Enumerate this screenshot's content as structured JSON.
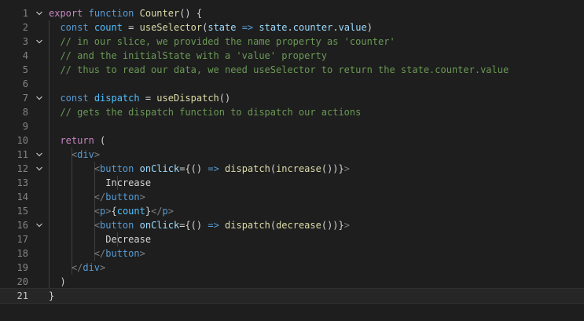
{
  "editor": {
    "language": "javascript-jsx",
    "colors": {
      "background": "#1e1e1e",
      "keyword": "#569cd6",
      "control": "#c586c0",
      "function": "#dcdcaa",
      "variable": "#9cdcfe",
      "constant": "#4fc1ff",
      "comment": "#6a9955",
      "tag_bracket": "#808080"
    },
    "current_line": 21,
    "lines": [
      {
        "number": "1",
        "fold": "chevron-down-icon",
        "guides": 0,
        "tokens": [
          {
            "t": "export",
            "c": "ctl"
          },
          {
            "t": " ",
            "c": "text"
          },
          {
            "t": "function",
            "c": "kw"
          },
          {
            "t": " ",
            "c": "text"
          },
          {
            "t": "Counter",
            "c": "fn"
          },
          {
            "t": "() {",
            "c": "punc"
          }
        ]
      },
      {
        "number": "2",
        "fold": "",
        "guides": 1,
        "tokens": [
          {
            "t": "  ",
            "c": "text"
          },
          {
            "t": "const",
            "c": "kw"
          },
          {
            "t": " ",
            "c": "text"
          },
          {
            "t": "count",
            "c": "const"
          },
          {
            "t": " = ",
            "c": "punc"
          },
          {
            "t": "useSelector",
            "c": "fn"
          },
          {
            "t": "(",
            "c": "punc"
          },
          {
            "t": "state",
            "c": "var"
          },
          {
            "t": " ",
            "c": "text"
          },
          {
            "t": "=>",
            "c": "kw"
          },
          {
            "t": " ",
            "c": "text"
          },
          {
            "t": "state",
            "c": "var"
          },
          {
            "t": ".",
            "c": "punc"
          },
          {
            "t": "counter",
            "c": "var"
          },
          {
            "t": ".",
            "c": "punc"
          },
          {
            "t": "value",
            "c": "var"
          },
          {
            "t": ")",
            "c": "punc"
          }
        ]
      },
      {
        "number": "3",
        "fold": "chevron-down-icon",
        "guides": 1,
        "tokens": [
          {
            "t": "  ",
            "c": "text"
          },
          {
            "t": "// in our slice, we provided the name property as 'counter'",
            "c": "cmt"
          }
        ]
      },
      {
        "number": "4",
        "fold": "",
        "guides": 1,
        "tokens": [
          {
            "t": "  ",
            "c": "text"
          },
          {
            "t": "// and the initialState with a 'value' property",
            "c": "cmt"
          }
        ]
      },
      {
        "number": "5",
        "fold": "",
        "guides": 1,
        "tokens": [
          {
            "t": "  ",
            "c": "text"
          },
          {
            "t": "// thus to read our data, we need useSelector to return the state.counter.value",
            "c": "cmt"
          }
        ]
      },
      {
        "number": "6",
        "fold": "",
        "guides": 1,
        "tokens": []
      },
      {
        "number": "7",
        "fold": "chevron-down-icon",
        "guides": 1,
        "tokens": [
          {
            "t": "  ",
            "c": "text"
          },
          {
            "t": "const",
            "c": "kw"
          },
          {
            "t": " ",
            "c": "text"
          },
          {
            "t": "dispatch",
            "c": "const"
          },
          {
            "t": " = ",
            "c": "punc"
          },
          {
            "t": "useDispatch",
            "c": "fn"
          },
          {
            "t": "()",
            "c": "punc"
          }
        ]
      },
      {
        "number": "8",
        "fold": "",
        "guides": 1,
        "tokens": [
          {
            "t": "  ",
            "c": "text"
          },
          {
            "t": "// gets the dispatch function to dispatch our actions",
            "c": "cmt"
          }
        ]
      },
      {
        "number": "9",
        "fold": "",
        "guides": 1,
        "tokens": []
      },
      {
        "number": "10",
        "fold": "",
        "guides": 1,
        "tokens": [
          {
            "t": "  ",
            "c": "text"
          },
          {
            "t": "return",
            "c": "ctl"
          },
          {
            "t": " (",
            "c": "punc"
          }
        ]
      },
      {
        "number": "11",
        "fold": "chevron-down-icon",
        "guides": 2,
        "tokens": [
          {
            "t": "    ",
            "c": "text"
          },
          {
            "t": "<",
            "c": "tag"
          },
          {
            "t": "div",
            "c": "el"
          },
          {
            "t": ">",
            "c": "tag"
          }
        ]
      },
      {
        "number": "12",
        "fold": "chevron-down-icon",
        "guides": 3,
        "tokens": [
          {
            "t": "        ",
            "c": "text"
          },
          {
            "t": "<",
            "c": "tag"
          },
          {
            "t": "button",
            "c": "el"
          },
          {
            "t": " ",
            "c": "text"
          },
          {
            "t": "onClick",
            "c": "attr"
          },
          {
            "t": "={",
            "c": "punc"
          },
          {
            "t": "()",
            "c": "punc"
          },
          {
            "t": " ",
            "c": "text"
          },
          {
            "t": "=>",
            "c": "kw"
          },
          {
            "t": " ",
            "c": "text"
          },
          {
            "t": "dispatch",
            "c": "fn"
          },
          {
            "t": "(",
            "c": "punc"
          },
          {
            "t": "increase",
            "c": "fn"
          },
          {
            "t": "())",
            "c": "punc"
          },
          {
            "t": "}",
            "c": "punc"
          },
          {
            "t": ">",
            "c": "tag"
          }
        ]
      },
      {
        "number": "13",
        "fold": "",
        "guides": 4,
        "tokens": [
          {
            "t": "          ",
            "c": "text"
          },
          {
            "t": "Increase",
            "c": "text"
          }
        ]
      },
      {
        "number": "14",
        "fold": "",
        "guides": 3,
        "tokens": [
          {
            "t": "        ",
            "c": "text"
          },
          {
            "t": "</",
            "c": "tag"
          },
          {
            "t": "button",
            "c": "el"
          },
          {
            "t": ">",
            "c": "tag"
          }
        ]
      },
      {
        "number": "15",
        "fold": "",
        "guides": 3,
        "tokens": [
          {
            "t": "        ",
            "c": "text"
          },
          {
            "t": "<",
            "c": "tag"
          },
          {
            "t": "p",
            "c": "el"
          },
          {
            "t": ">",
            "c": "tag"
          },
          {
            "t": "{",
            "c": "punc"
          },
          {
            "t": "count",
            "c": "const"
          },
          {
            "t": "}",
            "c": "punc"
          },
          {
            "t": "</",
            "c": "tag"
          },
          {
            "t": "p",
            "c": "el"
          },
          {
            "t": ">",
            "c": "tag"
          }
        ]
      },
      {
        "number": "16",
        "fold": "chevron-down-icon",
        "guides": 3,
        "tokens": [
          {
            "t": "        ",
            "c": "text"
          },
          {
            "t": "<",
            "c": "tag"
          },
          {
            "t": "button",
            "c": "el"
          },
          {
            "t": " ",
            "c": "text"
          },
          {
            "t": "onClick",
            "c": "attr"
          },
          {
            "t": "={",
            "c": "punc"
          },
          {
            "t": "()",
            "c": "punc"
          },
          {
            "t": " ",
            "c": "text"
          },
          {
            "t": "=>",
            "c": "kw"
          },
          {
            "t": " ",
            "c": "text"
          },
          {
            "t": "dispatch",
            "c": "fn"
          },
          {
            "t": "(",
            "c": "punc"
          },
          {
            "t": "decrease",
            "c": "fn"
          },
          {
            "t": "())",
            "c": "punc"
          },
          {
            "t": "}",
            "c": "punc"
          },
          {
            "t": ">",
            "c": "tag"
          }
        ]
      },
      {
        "number": "17",
        "fold": "",
        "guides": 4,
        "tokens": [
          {
            "t": "          ",
            "c": "text"
          },
          {
            "t": "Decrease",
            "c": "text"
          }
        ]
      },
      {
        "number": "18",
        "fold": "",
        "guides": 3,
        "tokens": [
          {
            "t": "        ",
            "c": "text"
          },
          {
            "t": "</",
            "c": "tag"
          },
          {
            "t": "button",
            "c": "el"
          },
          {
            "t": ">",
            "c": "tag"
          }
        ]
      },
      {
        "number": "19",
        "fold": "",
        "guides": 2,
        "tokens": [
          {
            "t": "    ",
            "c": "text"
          },
          {
            "t": "</",
            "c": "tag"
          },
          {
            "t": "div",
            "c": "el"
          },
          {
            "t": ">",
            "c": "tag"
          }
        ]
      },
      {
        "number": "20",
        "fold": "",
        "guides": 1,
        "tokens": [
          {
            "t": "  ",
            "c": "text"
          },
          {
            "t": ")",
            "c": "punc"
          }
        ]
      },
      {
        "number": "21",
        "fold": "",
        "guides": 0,
        "tokens": [
          {
            "t": "}",
            "c": "punc"
          }
        ]
      }
    ]
  }
}
